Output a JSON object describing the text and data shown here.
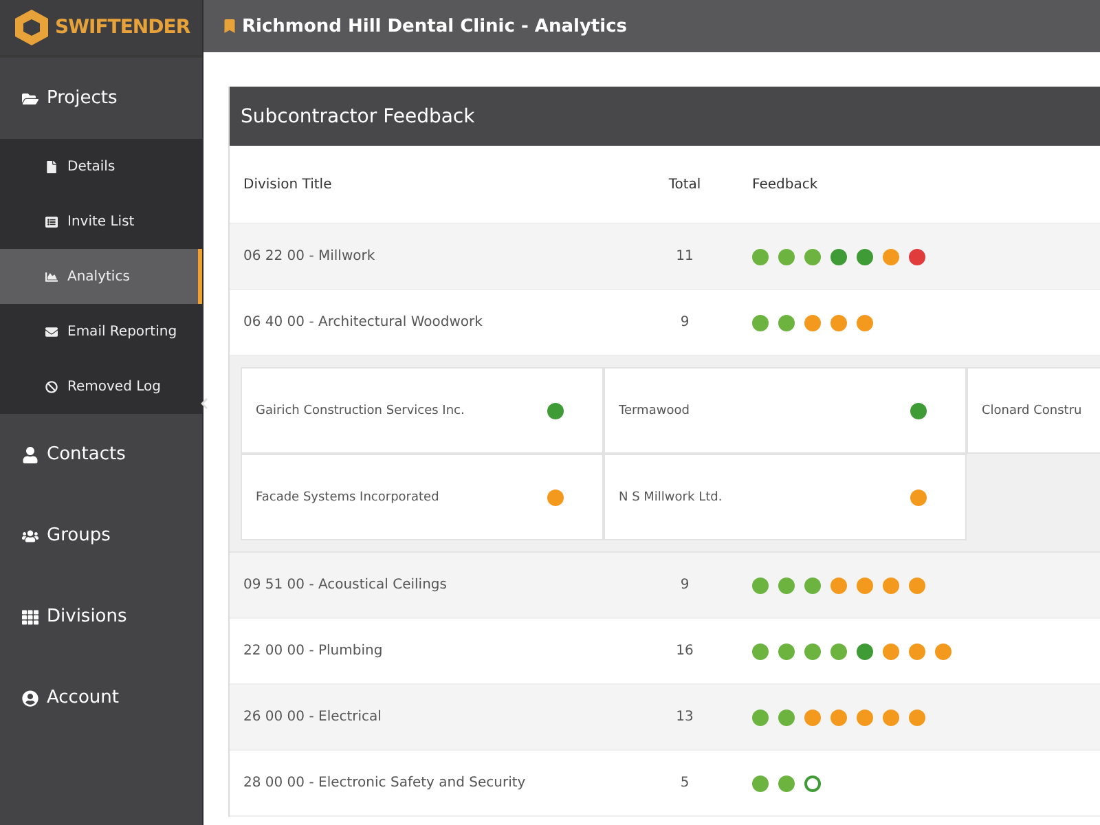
{
  "logo": {
    "text": "SWIFTENDER"
  },
  "header": {
    "title": "Richmond Hill Dental Clinic - Analytics"
  },
  "sidebar": {
    "items": [
      {
        "label": "Projects",
        "selected": false,
        "children": [
          {
            "label": "Details",
            "selected": false
          },
          {
            "label": "Invite List",
            "selected": false
          },
          {
            "label": "Analytics",
            "selected": true
          },
          {
            "label": "Email Reporting",
            "selected": false
          },
          {
            "label": "Removed Log",
            "selected": false
          }
        ]
      },
      {
        "label": "Contacts",
        "selected": false
      },
      {
        "label": "Groups",
        "selected": false
      },
      {
        "label": "Divisions",
        "selected": false
      },
      {
        "label": "Account",
        "selected": false
      }
    ]
  },
  "panel": {
    "title": "Subcontractor Feedback",
    "columns": [
      "Division Title",
      "Total",
      "Feedback"
    ],
    "rows": [
      {
        "title": "06 22 00 - Millwork",
        "total": "11",
        "feedback": [
          {
            "kind": "solid",
            "color": "#6cb33f"
          },
          {
            "kind": "solid",
            "color": "#6cb33f"
          },
          {
            "kind": "solid",
            "color": "#6cb33f"
          },
          {
            "kind": "solid",
            "color": "#3f9b35"
          },
          {
            "kind": "solid",
            "color": "#3f9b35"
          },
          {
            "kind": "solid",
            "color": "#f39a1e"
          },
          {
            "kind": "solid",
            "color": "#e23b3b"
          }
        ]
      },
      {
        "title": "06 40 00 - Architectural Woodwork",
        "total": "9",
        "feedback": [
          {
            "kind": "solid",
            "color": "#6cb33f"
          },
          {
            "kind": "solid",
            "color": "#6cb33f"
          },
          {
            "kind": "solid",
            "color": "#f39a1e"
          },
          {
            "kind": "solid",
            "color": "#f39a1e"
          },
          {
            "kind": "solid",
            "color": "#f39a1e"
          }
        ],
        "companies": [
          {
            "name": "Gairich Construction Services Inc.",
            "color": "#3f9b35"
          },
          {
            "name": "Termawood",
            "color": "#3f9b35"
          },
          {
            "name": "Clonard Constru"
          },
          {
            "name": "Facade Systems Incorporated",
            "color": "#f39a1e"
          },
          {
            "name": "N S Millwork Ltd.",
            "color": "#f39a1e"
          }
        ]
      },
      {
        "title": "09 51 00 - Acoustical Ceilings",
        "total": "9",
        "feedback": [
          {
            "kind": "solid",
            "color": "#6cb33f"
          },
          {
            "kind": "solid",
            "color": "#6cb33f"
          },
          {
            "kind": "solid",
            "color": "#6cb33f"
          },
          {
            "kind": "solid",
            "color": "#f39a1e"
          },
          {
            "kind": "solid",
            "color": "#f39a1e"
          },
          {
            "kind": "solid",
            "color": "#f39a1e"
          },
          {
            "kind": "solid",
            "color": "#f39a1e"
          }
        ]
      },
      {
        "title": "22 00 00 - Plumbing",
        "total": "16",
        "feedback": [
          {
            "kind": "solid",
            "color": "#6cb33f"
          },
          {
            "kind": "solid",
            "color": "#6cb33f"
          },
          {
            "kind": "solid",
            "color": "#6cb33f"
          },
          {
            "kind": "solid",
            "color": "#6cb33f"
          },
          {
            "kind": "solid",
            "color": "#3f9b35"
          },
          {
            "kind": "solid",
            "color": "#f39a1e"
          },
          {
            "kind": "solid",
            "color": "#f39a1e"
          },
          {
            "kind": "solid",
            "color": "#f39a1e"
          }
        ]
      },
      {
        "title": "26 00 00 - Electrical",
        "total": "13",
        "feedback": [
          {
            "kind": "solid",
            "color": "#6cb33f"
          },
          {
            "kind": "solid",
            "color": "#6cb33f"
          },
          {
            "kind": "solid",
            "color": "#f39a1e"
          },
          {
            "kind": "solid",
            "color": "#f39a1e"
          },
          {
            "kind": "solid",
            "color": "#f39a1e"
          },
          {
            "kind": "solid",
            "color": "#f39a1e"
          },
          {
            "kind": "solid",
            "color": "#f39a1e"
          }
        ]
      },
      {
        "title": "28 00 00 - Electronic Safety and Security",
        "total": "5",
        "feedback": [
          {
            "kind": "solid",
            "color": "#6cb33f"
          },
          {
            "kind": "solid",
            "color": "#6cb33f"
          },
          {
            "kind": "outline",
            "color": "#3f9b35"
          }
        ]
      }
    ]
  }
}
